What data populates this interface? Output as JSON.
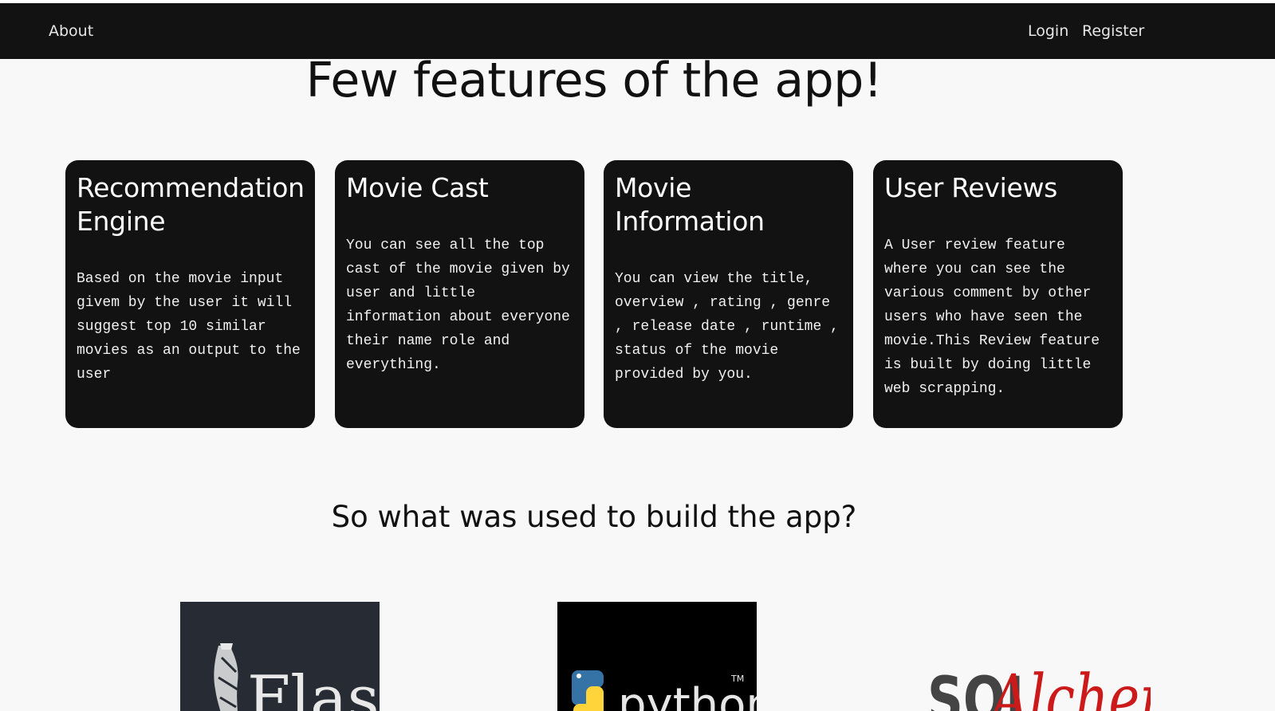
{
  "nav": {
    "about": "About",
    "login": "Login",
    "register": "Register"
  },
  "hero": {
    "title": "Few features of the app!"
  },
  "features": [
    {
      "title": "Recommendation Engine",
      "text": "Based on the movie input givem by the user it will suggest top 10 similar movies as an output to the user"
    },
    {
      "title": "Movie Cast",
      "text": "You can see all the top cast of the movie given by user and little information about everyone their name role and everything."
    },
    {
      "title": "Movie Information",
      "text": "You can view the title, overview , rating , genre , release date , runtime , status of the movie provided by you."
    },
    {
      "title": "User Reviews",
      "text": "A User review feature where you can see the various comment by other users who have seen the movie.This Review feature is built by doing little web scrapping."
    }
  ],
  "tech": {
    "title": "So what was used to build the app?",
    "logos": [
      {
        "name": "flask-logo",
        "text": "Flask"
      },
      {
        "name": "python-logo",
        "text": "python",
        "trademark": "TM"
      },
      {
        "name": "sqlalchemy-logo",
        "text_part1": "SQL",
        "text_part2": "Alchemy"
      }
    ]
  },
  "colors": {
    "navbar": "#121212",
    "card": "#121212",
    "page_bg": "#f8f8f8",
    "sqlalchemy_red": "#cc1a1a",
    "sqlalchemy_gray": "#444444",
    "python_blue": "#3572a5",
    "python_yellow": "#ffd43b"
  }
}
